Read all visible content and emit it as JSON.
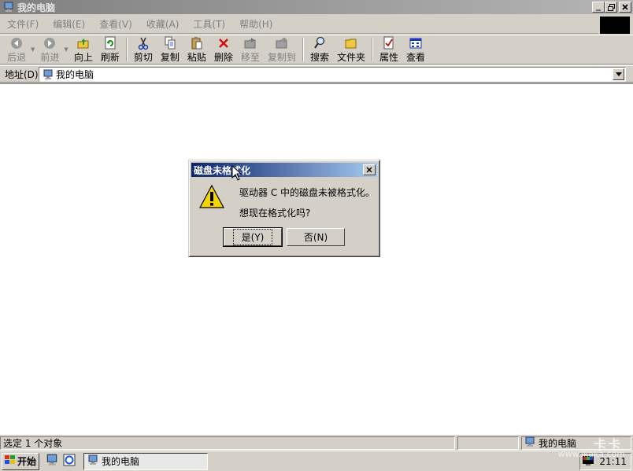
{
  "window": {
    "title": "我的电脑",
    "menu": [
      "文件(F)",
      "编辑(E)",
      "查看(V)",
      "收藏(A)",
      "工具(T)",
      "帮助(H)"
    ]
  },
  "toolbar": {
    "back": "后退",
    "forward": "前进",
    "up": "向上",
    "refresh": "刷新",
    "cut": "剪切",
    "copy": "复制",
    "paste": "粘贴",
    "delete": "删除",
    "move_to": "移至",
    "copy_to": "复制到",
    "search": "搜索",
    "folders": "文件夹",
    "properties": "属性",
    "view": "查看"
  },
  "address": {
    "label": "地址(D)",
    "value": "我的电脑"
  },
  "dialog": {
    "title": "磁盘未格式化",
    "message1": "驱动器 C 中的磁盘未被格式化。",
    "message2": "想现在格式化吗?",
    "yes": "是(Y)",
    "no": "否(N)"
  },
  "statusbar": {
    "left": "选定 1 个对象",
    "right": "我的电脑"
  },
  "taskbar": {
    "start": "开始",
    "task": "我的电脑",
    "clock": "21:11"
  },
  "watermark": {
    "text": "卡卡",
    "url": "www.ikaka.com"
  },
  "colors": {
    "dialog_title": "#0a246a",
    "window_inactive_title": "#808080",
    "warning": "#f5d400"
  }
}
